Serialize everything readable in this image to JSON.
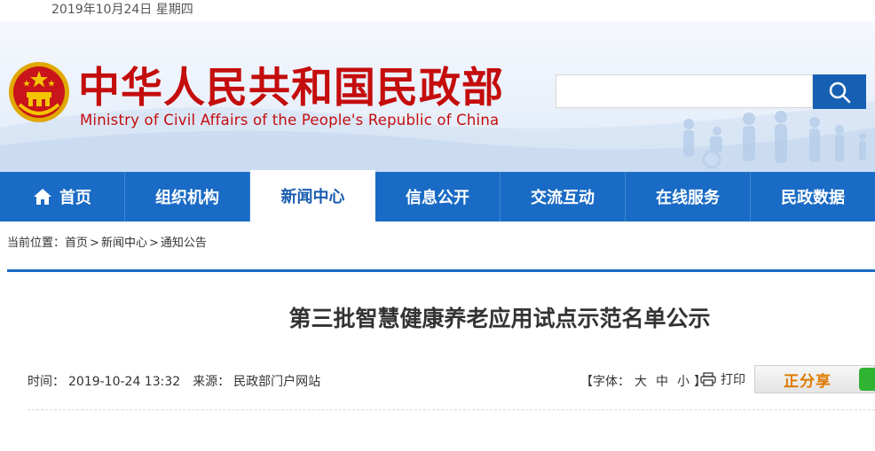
{
  "topbar": {
    "date": "2019年10月24日  星期四"
  },
  "header": {
    "title": "中华人民共和国民政部",
    "subtitle": "Ministry of Civil Affairs of the People's Republic of China",
    "search": {
      "placeholder": "",
      "value": ""
    }
  },
  "nav": {
    "items": [
      {
        "label": "首页"
      },
      {
        "label": "组织机构"
      },
      {
        "label": "新闻中心"
      },
      {
        "label": "信息公开"
      },
      {
        "label": "交流互动"
      },
      {
        "label": "在线服务"
      },
      {
        "label": "民政数据"
      }
    ],
    "active_index": 2
  },
  "breadcrumb": {
    "prefix": "当前位置：",
    "items": [
      "首页",
      "新闻中心",
      "通知公告"
    ],
    "separator": ">"
  },
  "article": {
    "title": "第三批智慧健康养老应用试点示范名单公示",
    "time_label": "时间：",
    "time_value": "2019-10-24 13:32",
    "source_label": "来源：",
    "source_value": "民政部门户网站",
    "font_prefix": "【字体：",
    "font_large": "大",
    "font_medium": "中",
    "font_small": "小",
    "font_suffix": "】",
    "print_label": "打印",
    "share_label": "正分享"
  },
  "colors": {
    "nav_blue": "#1a6bc5",
    "title_red": "#c40d0d",
    "share_orange": "#e07a00"
  }
}
